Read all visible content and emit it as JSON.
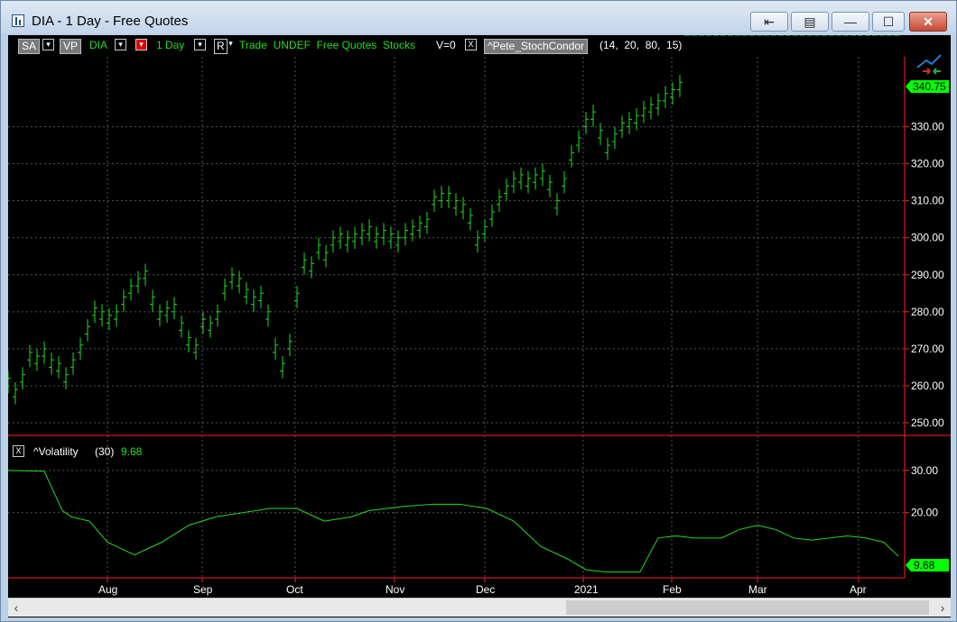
{
  "window": {
    "title": "DIA - 1 Day - Free Quotes",
    "controls": {
      "pin": "⇤",
      "note": "▤",
      "minimize": "—",
      "maximize": "☐",
      "close": "✕"
    }
  },
  "toolbar": {
    "sa": "SA",
    "vp": "VP",
    "symbol": "DIA",
    "period": "1 Day",
    "r": "R",
    "info": "Trade  UNDEF  Free Quotes  Stocks",
    "v_label": "V=0",
    "close_x": "X",
    "indicator_name": "^Pete_StochCondor",
    "indicator_params": "(14,  20,  80,  15)"
  },
  "volatility_panel": {
    "close_x": "X",
    "name": "^Volatility",
    "param": "(30)",
    "value": "9.68"
  },
  "colors": {
    "accent": "#00ff00",
    "bars": "#22dd22",
    "axis": "#ff2222",
    "background": "#000000"
  },
  "chart_data": [
    {
      "type": "line",
      "title": "DIA",
      "price_label": "340.75",
      "yticks": [
        "250.00",
        "260.00",
        "270.00",
        "280.00",
        "290.00",
        "300.00",
        "310.00",
        "320.00",
        "330.00"
      ],
      "ylim": [
        250,
        345
      ],
      "x": [
        0,
        8,
        16,
        24,
        32,
        40,
        48,
        56,
        64,
        72,
        80,
        88,
        96,
        104,
        112,
        120,
        128,
        136,
        144,
        152,
        160,
        168,
        176,
        184,
        192,
        200,
        208,
        216,
        224,
        232,
        240,
        248,
        256,
        264,
        272,
        280,
        288,
        296,
        304,
        312,
        320,
        328,
        336,
        344,
        352,
        360,
        368,
        376,
        384,
        392,
        400,
        408,
        416,
        424,
        432,
        440,
        448,
        456,
        464,
        472,
        480,
        488,
        496,
        504,
        512,
        520,
        528,
        536,
        544,
        552,
        560,
        568,
        576,
        584,
        592,
        600,
        608,
        616,
        624,
        632,
        640,
        648,
        656,
        664,
        672,
        680,
        688,
        696,
        704,
        712,
        720,
        728,
        736,
        744,
        752,
        760,
        768,
        776,
        784,
        792,
        800,
        808,
        816,
        824,
        832,
        840,
        848,
        856,
        864,
        872,
        880,
        888,
        896,
        904,
        912,
        920,
        928,
        936,
        944,
        952,
        960,
        968,
        976,
        984
      ],
      "values": [
        261,
        258,
        262,
        268,
        267,
        269,
        266,
        265,
        262,
        266,
        270,
        275,
        280,
        279,
        278,
        279,
        283,
        286,
        288,
        290,
        283,
        279,
        280,
        281,
        276,
        272,
        270,
        277,
        276,
        279,
        286,
        289,
        288,
        285,
        283,
        284,
        279,
        270,
        265,
        271,
        284,
        293,
        292,
        297,
        295,
        299,
        300,
        299,
        300,
        301,
        302,
        300,
        301,
        300,
        299,
        301,
        302,
        303,
        304,
        310,
        311,
        311,
        309,
        308,
        305,
        299,
        302,
        306,
        310,
        313,
        315,
        316,
        315,
        316,
        317,
        314,
        309,
        315,
        322,
        326,
        331,
        333,
        328,
        324,
        327,
        330,
        331,
        332,
        334,
        335,
        336,
        338,
        339,
        341
      ]
    },
    {
      "type": "line",
      "title": "^Volatility",
      "value_label": "9.68",
      "yticks": [
        "20.00",
        "30.00"
      ],
      "ylim": [
        5,
        37
      ],
      "x": [
        0,
        40,
        60,
        70,
        90,
        110,
        140,
        170,
        200,
        230,
        260,
        290,
        320,
        350,
        380,
        400,
        420,
        440,
        470,
        500,
        530,
        560,
        590,
        620,
        640,
        660,
        680,
        700,
        710,
        720,
        740,
        760,
        790,
        810,
        830,
        850,
        870,
        890,
        910,
        930,
        950,
        970,
        986
      ],
      "values": [
        30,
        29.8,
        20.5,
        19,
        18,
        13,
        10,
        13,
        17,
        19,
        20,
        21,
        21,
        18,
        19,
        20.5,
        21,
        21.5,
        22,
        22,
        21,
        18,
        12,
        9,
        6.5,
        6,
        6,
        6,
        10,
        14,
        14.5,
        14,
        14,
        16,
        17,
        16,
        14,
        13.5,
        14,
        14.5,
        14,
        13,
        9.68
      ]
    }
  ],
  "x_axis": {
    "labels": [
      "Aug",
      "Sep",
      "Oct",
      "Nov",
      "Dec",
      "2021",
      "Feb",
      "Mar",
      "Apr"
    ]
  },
  "scrollbar": {
    "left_arrow": "‹",
    "right_arrow": "›"
  }
}
